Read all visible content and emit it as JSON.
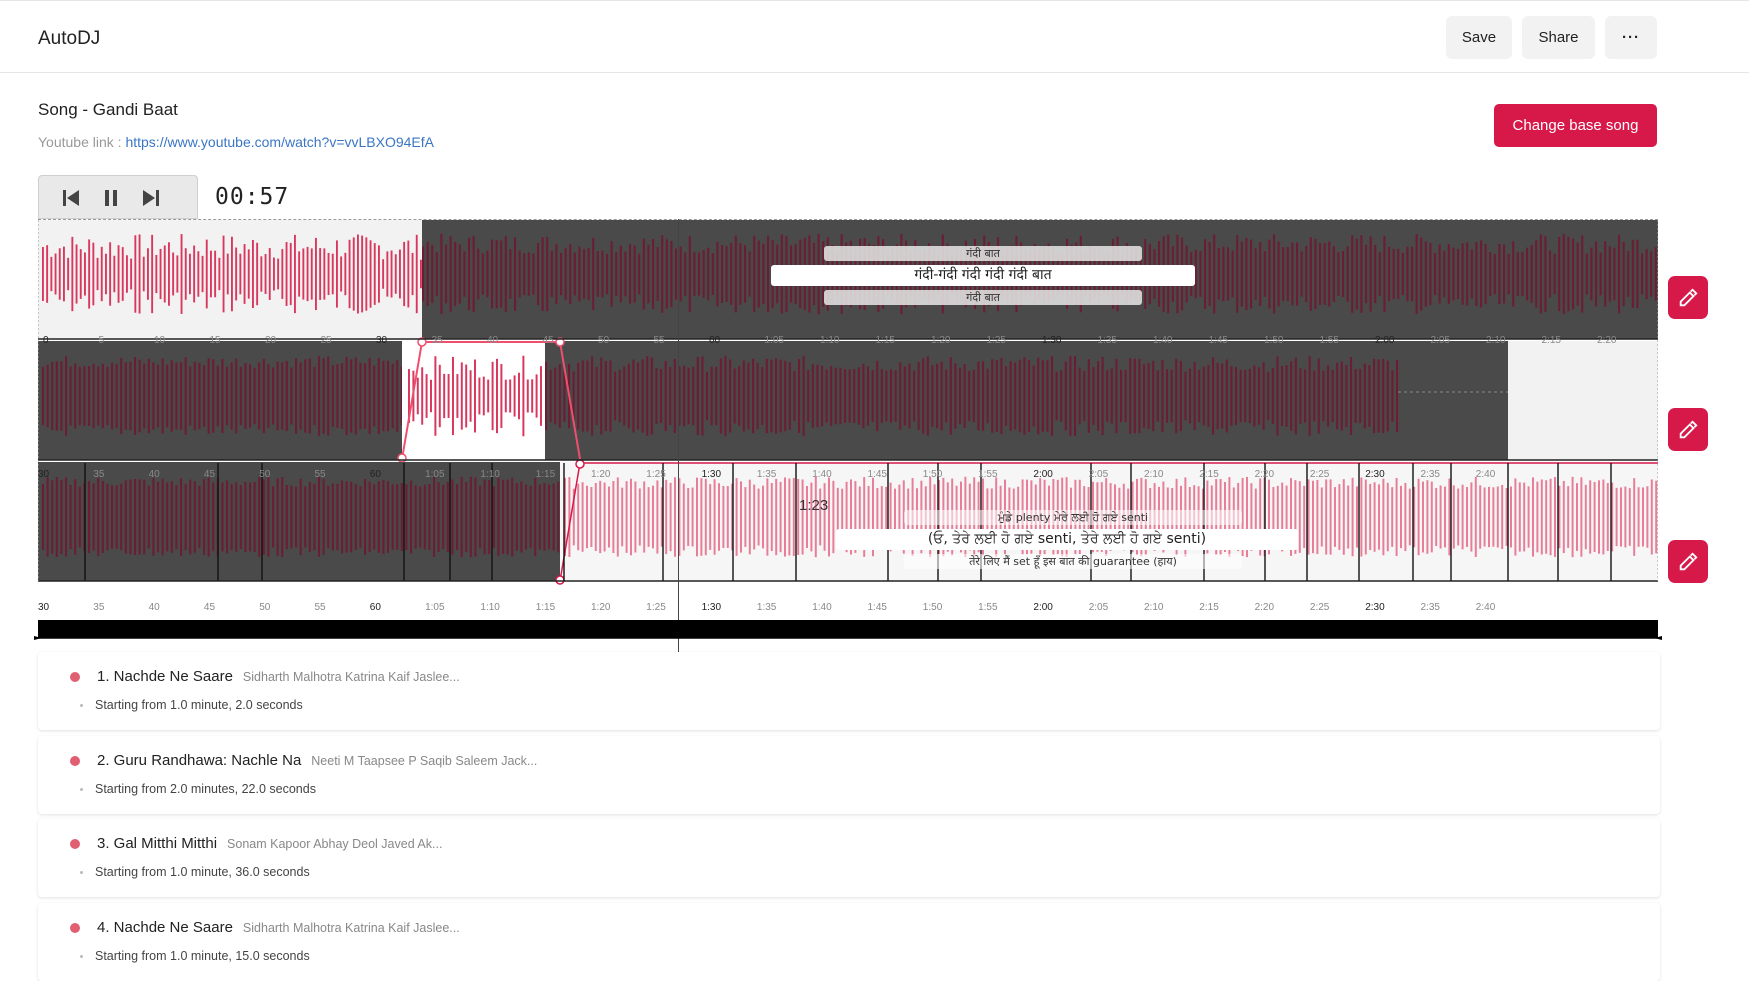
{
  "header": {
    "app_title": "AutoDJ",
    "save_label": "Save",
    "share_label": "Share",
    "more_label": "···"
  },
  "song": {
    "title": "Song - Gandi Baat",
    "youtube_label": "Youtube link : ",
    "youtube_url": "https://www.youtube.com/watch?v=vvLBXO94EfA",
    "change_label": "Change base song"
  },
  "player": {
    "time": "00:57",
    "controls": [
      "prev-icon",
      "pause-icon",
      "next-icon"
    ]
  },
  "tracks": [
    {
      "lyrics": {
        "prev": "गंदी बात",
        "current": "गंदी-गंदी गंदी गंदी गंदी बात",
        "next": "गंदी बात"
      },
      "ticks": [
        "0",
        "5",
        "10",
        "15",
        "20",
        "25",
        "30",
        "35",
        "40",
        "45",
        "50",
        "55",
        "60",
        "1:05",
        "1:10",
        "1:15",
        "1:20",
        "1:25",
        "1:30",
        "1:35",
        "1:40",
        "1:45",
        "1:50",
        "1:55",
        "2:00",
        "2:05",
        "2:10",
        "2:15",
        "2:20"
      ]
    },
    {
      "ticks": [
        "30",
        "35",
        "40",
        "45",
        "50",
        "55",
        "60",
        "1:05",
        "1:10",
        "1:15",
        "1:20",
        "1:25",
        "1:30",
        "1:35",
        "1:40",
        "1:45",
        "1:50",
        "1:55",
        "2:00",
        "2:05",
        "2:10",
        "2:15",
        "2:20",
        "2:25",
        "2:30",
        "2:35",
        "2:40"
      ]
    },
    {
      "marker": "1:23",
      "lyrics": {
        "prev": "ਮੁੰਡੇ plenty ਮੇਰੇ ਲਈ ਹੋ ਗਏ senti",
        "current": "(ਓ, ਤੇਰੇ ਲਈ ਹੋ ਗਏ senti, ਤੇਰੇ ਲਈ ਹੋ ਗਏ senti)",
        "next": "तेरे लिए मैं set हूँ इस बात की guarantee (हाय)"
      },
      "ticks": [
        "30",
        "35",
        "40",
        "45",
        "50",
        "55",
        "60",
        "1:05",
        "1:10",
        "1:15",
        "1:20",
        "1:25",
        "1:30",
        "1:35",
        "1:40",
        "1:45",
        "1:50",
        "1:55",
        "2:00",
        "2:05",
        "2:10",
        "2:15",
        "2:20",
        "2:25",
        "2:30",
        "2:35",
        "2:40"
      ]
    }
  ],
  "queue": [
    {
      "title": "1. Nachde Ne Saare",
      "artists": "Sidharth Malhotra Katrina Kaif Jaslee...",
      "start": "Starting from 1.0 minute, 2.0 seconds"
    },
    {
      "title": "2. Guru Randhawa: Nachle Na",
      "artists": "Neeti M Taapsee P Saqib Saleem Jack...",
      "start": "Starting from 2.0 minutes, 22.0 seconds"
    },
    {
      "title": "3. Gal Mitthi Mitthi",
      "artists": "Sonam Kapoor Abhay Deol Javed Ak...",
      "start": "Starting from 1.0 minute, 36.0 seconds"
    },
    {
      "title": "4. Nachde Ne Saare",
      "artists": "Sidharth Malhotra Katrina Kaif Jaslee...",
      "start": "Starting from 1.0 minute, 15.0 seconds"
    }
  ],
  "colors": {
    "accent": "#d7194a",
    "wave_active": "#d9385e",
    "wave_dim": "#6b1d33",
    "wave_light": "#e87d97",
    "track_bg_dark": "#555555",
    "track_bg_light": "#f2f2f2"
  }
}
